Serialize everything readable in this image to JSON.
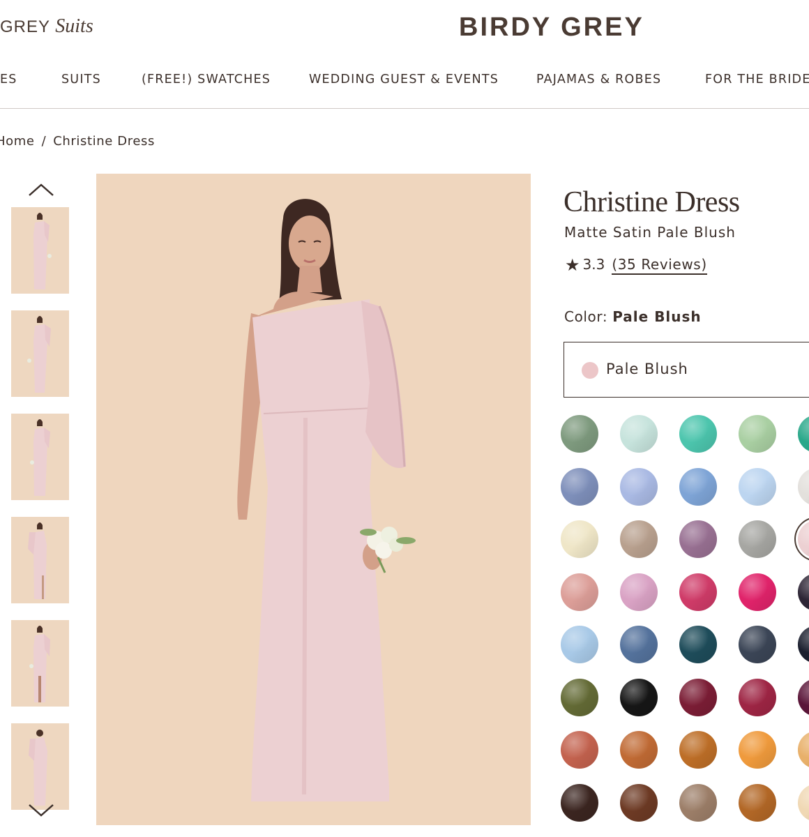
{
  "header": {
    "sub_brand_prefix": "GREY",
    "sub_brand_suffix": "Suits",
    "brand": "BIRDY GREY"
  },
  "nav": {
    "items": [
      {
        "label": "ES"
      },
      {
        "label": "SUITS"
      },
      {
        "label": "(FREE!) SWATCHES"
      },
      {
        "label": "WEDDING GUEST & EVENTS"
      },
      {
        "label": "PAJAMAS & ROBES"
      },
      {
        "label": "FOR THE BRIDE"
      }
    ]
  },
  "breadcrumb": {
    "home": "Home",
    "separator": "/",
    "current": "Christine Dress"
  },
  "gallery": {
    "thumbnail_count": 6,
    "background_color": "#efd6be",
    "dress_color": "#ecd0d2"
  },
  "product": {
    "title": "Christine Dress",
    "subtitle": "Matte Satin Pale Blush",
    "rating": "3.3",
    "reviews": "(35 Reviews)",
    "color_label": "Color:",
    "color_value": "Pale Blush",
    "selected_option": "Pale Blush",
    "selected_option_color": "#ecc6c8"
  },
  "swatches": {
    "rows": [
      [
        "#7e9a7e",
        "#c6e3dc",
        "#4cc5ad",
        "#a9cfa2",
        "#2aa88a"
      ],
      [
        "#7e8fba",
        "#a9b9e3",
        "#7ea4d6",
        "#bcd5f0",
        "#e3e0dc"
      ],
      [
        "#efe6c7",
        "#b8a08e",
        "#987092",
        "#a6a6a2",
        "#ecd0d2"
      ],
      [
        "#dc9e98",
        "#d9a2c4",
        "#cf3b68",
        "#e0236a",
        "#2d2535"
      ],
      [
        "#a8c9e7",
        "#54729c",
        "#1e4c5a",
        "#3b4556",
        "#1b1f2e"
      ],
      [
        "#636a35",
        "#161616",
        "#7b1d35",
        "#9e2544",
        "#5a1538"
      ],
      [
        "#c3624e",
        "#c06a34",
        "#bd6e27",
        "#ef9a3c",
        "#e8b06a"
      ],
      [
        "#3b2520",
        "#6d3a24",
        "#9c7e68",
        "#b26726",
        "#f0d8b4"
      ]
    ],
    "selected": "#ecd0d2"
  }
}
